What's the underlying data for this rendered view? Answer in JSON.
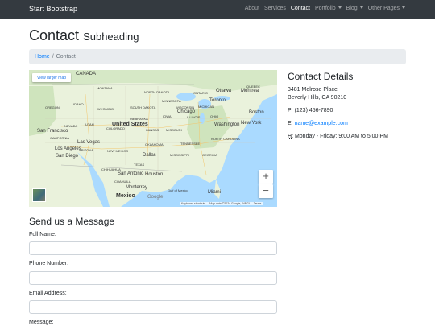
{
  "navbar": {
    "brand": "Start Bootstrap",
    "items": [
      {
        "label": "About",
        "dropdown": false,
        "active": false
      },
      {
        "label": "Services",
        "dropdown": false,
        "active": false
      },
      {
        "label": "Contact",
        "dropdown": false,
        "active": true
      },
      {
        "label": "Portfolio",
        "dropdown": true,
        "active": false
      },
      {
        "label": "Blog",
        "dropdown": true,
        "active": false
      },
      {
        "label": "Other Pages",
        "dropdown": true,
        "active": false
      }
    ]
  },
  "page": {
    "title": "Contact",
    "subheading": "Subheading"
  },
  "breadcrumb": {
    "home": "Home",
    "separator": "/",
    "current": "Contact"
  },
  "map": {
    "view_larger": "View larger map",
    "zoom_in": "+",
    "zoom_out": "−",
    "google": "Google",
    "attribution": {
      "shortcuts": "Keyboard shortcuts",
      "map_data": "Map data ©2024 Google, INEGI",
      "terms": "Terms"
    },
    "labels": {
      "canada": "CANADA",
      "united_states": "United States",
      "mexico": "Mexico",
      "montana": "MONTANA",
      "north_dakota": "NORTH DAKOTA",
      "minnesota": "MINNESOTA",
      "ontario": "ONTARIO",
      "quebec": "QUEBEC",
      "ottawa": "Ottawa",
      "montreal": "Montreal",
      "toronto": "Toronto",
      "michigan": "MICHIGAN",
      "wisconsin": "WISCONSIN",
      "idaho": "IDAHO",
      "oregon": "OREGON",
      "wyoming": "WYOMING",
      "south_dakota": "SOUTH DAKOTA",
      "nebraska": "NEBRASKA",
      "iowa": "IOWA",
      "illinois": "ILLINOIS",
      "ohio": "OHIO",
      "chicago": "Chicago",
      "new_york": "New York",
      "boston": "Boston",
      "nevada": "NEVADA",
      "utah": "UTAH",
      "colorado": "COLORADO",
      "kansas": "KANSAS",
      "missouri": "MISSOURI",
      "washington": "Washington",
      "san_francisco": "San Francisco",
      "california": "CALIFORNIA",
      "las_vegas": "Las Vegas",
      "arizona": "ARIZONA",
      "new_mexico": "NEW MEXICO",
      "oklahoma": "OKLAHOMA",
      "tennessee": "TENNESSEE",
      "north_carolina": "NORTH CAROLINA",
      "los_angeles": "Los Angeles",
      "san_diego": "San Diego",
      "dallas": "Dallas",
      "mississippi": "MISSISSIPPI",
      "georgia": "GEORGIA",
      "texas": "TEXAS",
      "san_antonio": "San Antonio",
      "houston": "Houston",
      "chihuahua": "CHIHUAHUA",
      "coahuila": "COAHUILA",
      "monterrey": "Monterrey",
      "gulf_of_mexico": "Gulf of Mexico",
      "miami": "Miami"
    }
  },
  "contact": {
    "title": "Contact Details",
    "address_line1": "3481 Melrose Place",
    "address_line2": "Beverly Hills, CA 90210",
    "phone_abbr": "P",
    "phone": "(123) 456-7890",
    "email_abbr": "E",
    "email": "name@example.com",
    "hours_abbr": "H",
    "hours": "Monday - Friday: 9:00 AM to 5:00 PM"
  },
  "form": {
    "title": "Send us a Message",
    "full_name_label": "Full Name:",
    "full_name_value": "",
    "phone_label": "Phone Number:",
    "phone_value": "",
    "email_label": "Email Address:",
    "email_value": "",
    "message_label": "Message:"
  },
  "colors": {
    "navbar_bg": "#343a40",
    "link": "#007bff",
    "breadcrumb_bg": "#e9ecef",
    "water": "#aadaff",
    "land": "#eaf2dc",
    "forest": "#cfe4bd"
  }
}
